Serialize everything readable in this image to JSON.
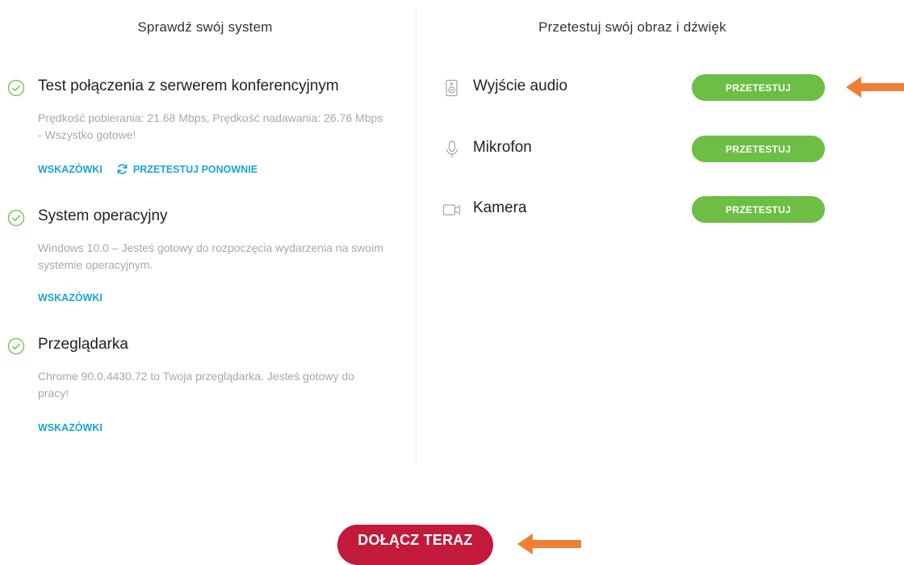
{
  "left_panel": {
    "title": "Sprawdź swój system",
    "checks": [
      {
        "icon": "check-circle-icon",
        "title": "Test połączenia z serwerem konferencyjnym",
        "description": "Prędkość pobierania: 21.68 Mbps, Prędkość nadawania: 26.76 Mbps - Wszystko gotowe!",
        "tips_label": "WSKAZÓWKI",
        "retest_label": "PRZETESTUJ PONOWNIE"
      },
      {
        "icon": "check-circle-icon",
        "title": "System operacyjny",
        "description": "Windows 10.0 – Jesteś gotowy do rozpoczęcia wydarzenia na swoim systemie operacyjnym.",
        "tips_label": "WSKAZÓWKI"
      },
      {
        "icon": "check-circle-icon",
        "title": "Przeglądarka",
        "description": "Chrome 90.0.4430.72 to Twoja przeglądarka. Jesteś gotowy do pracy!",
        "tips_label": "WSKAZÓWKI"
      }
    ]
  },
  "right_panel": {
    "title": "Przetestuj swój obraz i dźwięk",
    "devices": [
      {
        "icon": "speaker-icon",
        "label": "Wyjście audio",
        "button_label": "PRZETESTUJ"
      },
      {
        "icon": "microphone-icon",
        "label": "Mikrofon",
        "button_label": "PRZETESTUJ"
      },
      {
        "icon": "camera-icon",
        "label": "Kamera",
        "button_label": "PRZETESTUJ"
      }
    ]
  },
  "join_label": "DOŁĄCZ TERAZ",
  "colors": {
    "success_green": "#6dbe45",
    "link_blue": "#1da2dc",
    "join_red": "#c3193a",
    "annotation_orange": "#f07f35"
  }
}
